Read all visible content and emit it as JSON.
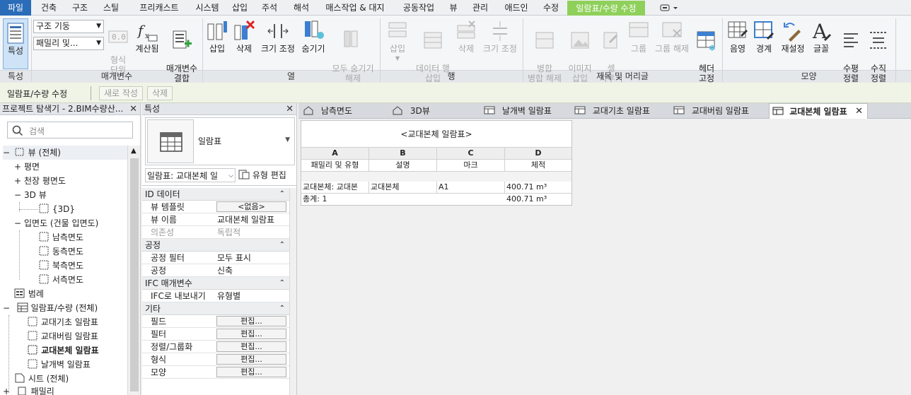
{
  "tabs": [
    "파일",
    "건축",
    "구조",
    "스틸",
    "프리캐스트",
    "시스템",
    "삽입",
    "주석",
    "해석",
    "매스작업 & 대지",
    "공동작업",
    "뷰",
    "관리",
    "애드인",
    "수정",
    "일람표/수량 수정"
  ],
  "ribbon": {
    "properties_btn": "특성",
    "combo_1": "구조 기둥",
    "combo_2": "패밀리 및...",
    "format_unit": "형식\n단위",
    "calculated": "계산됨",
    "combine_params": "매개변수\n결합",
    "insert": "삽입",
    "delete": "삭제",
    "resize": "크기 조정",
    "hide": "숨기기",
    "unhide_all": "모두 숨기기\n해제",
    "row_insert": "삽입",
    "row_data_insert": "데이터 행\n삽입",
    "row_delete": "삭제",
    "row_resize": "크기 조정",
    "merge_unmerge": "병합\n병합 해제",
    "insert_image": "이미지\n삽입",
    "clear_cell": "셀\n지우기",
    "group": "그룹",
    "ungroup": "그룹 해제",
    "freeze_header": "헤더\n고정",
    "shading": "음영",
    "borders": "경계",
    "reset": "재설정",
    "font": "글꼴",
    "align_h": "수평\n정렬",
    "align_v": "수직\n정렬",
    "panels": [
      "특성",
      "매개변수",
      "열",
      "행",
      "제목 및 머리글",
      "모양"
    ]
  },
  "context_bar": {
    "label": "일람표/수량 수정",
    "new_btn": "새로 작성",
    "delete_btn": "삭제"
  },
  "browser": {
    "title": "프로젝트 탐색기 - 2.BIM수량산...",
    "search_placeholder": "검색",
    "items": [
      {
        "label": "뷰 (전체)",
        "expander": "−"
      },
      {
        "label": "평면",
        "expander": "+"
      },
      {
        "label": "천장 평면도",
        "expander": "+"
      },
      {
        "label": "3D 뷰",
        "expander": "−"
      },
      {
        "label": "{3D}",
        "expander": ""
      },
      {
        "label": "입면도 (건물 입면도)",
        "expander": "−"
      },
      {
        "label": "남측면도",
        "expander": ""
      },
      {
        "label": "동측면도",
        "expander": ""
      },
      {
        "label": "북측면도",
        "expander": ""
      },
      {
        "label": "서측면도",
        "expander": ""
      },
      {
        "label": "범례",
        "expander": ""
      },
      {
        "label": "일람표/수량 (전체)",
        "expander": "−"
      },
      {
        "label": "교대기초 일람표",
        "expander": ""
      },
      {
        "label": "교대버림 일람표",
        "expander": ""
      },
      {
        "label": "교대본체 일람표",
        "expander": ""
      },
      {
        "label": "날개벽 일람표",
        "expander": ""
      },
      {
        "label": "시트 (전체)",
        "expander": ""
      },
      {
        "label": "패밀리",
        "expander": "+"
      }
    ]
  },
  "properties": {
    "title": "특성",
    "type_label": "일람표",
    "selector": "일람표: 교대본체 일",
    "edit_type": "유형 편집",
    "groups": [
      {
        "name": "ID 데이터",
        "rows": [
          {
            "k": "뷰 템플릿",
            "v": "<없음>",
            "button": true
          },
          {
            "k": "뷰 이름",
            "v": "교대본체 일람표"
          },
          {
            "k": "의존성",
            "v": "독립적",
            "disabled": true
          }
        ]
      },
      {
        "name": "공정",
        "rows": [
          {
            "k": "공정 필터",
            "v": "모두 표시"
          },
          {
            "k": "공정",
            "v": "신축"
          }
        ]
      },
      {
        "name": "IFC 매개변수",
        "rows": [
          {
            "k": "IFC로 내보내기",
            "v": "유형별"
          }
        ]
      },
      {
        "name": "기타",
        "rows": [
          {
            "k": "필드",
            "v": "편집...",
            "button": true
          },
          {
            "k": "필터",
            "v": "편집...",
            "button": true
          },
          {
            "k": "정렬/그룹화",
            "v": "편집...",
            "button": true
          },
          {
            "k": "형식",
            "v": "편집...",
            "button": true
          },
          {
            "k": "모양",
            "v": "편집...",
            "button": true
          }
        ]
      }
    ]
  },
  "view_tabs": [
    {
      "label": "남측면도",
      "icon": "home-icon"
    },
    {
      "label": "3D뷰",
      "icon": "home-icon"
    },
    {
      "label": "날개벽 일람표",
      "icon": "table-icon"
    },
    {
      "label": "교대기초 일람표",
      "icon": "table-icon"
    },
    {
      "label": "교대버림 일람표",
      "icon": "table-icon"
    },
    {
      "label": "교대본체 일람표",
      "icon": "table-icon",
      "active": true
    }
  ],
  "schedule": {
    "title": "<교대본체 일람표>",
    "col_letters": [
      "A",
      "B",
      "C",
      "D"
    ],
    "col_names": [
      "패밀리 및 유형",
      "설명",
      "마크",
      "체적"
    ],
    "rows": [
      [
        "교대본체: 교대본",
        "교대본체",
        "A1",
        "400.71 m³"
      ]
    ],
    "total": [
      "총계: 1",
      "",
      "",
      "400.71 m³"
    ]
  }
}
